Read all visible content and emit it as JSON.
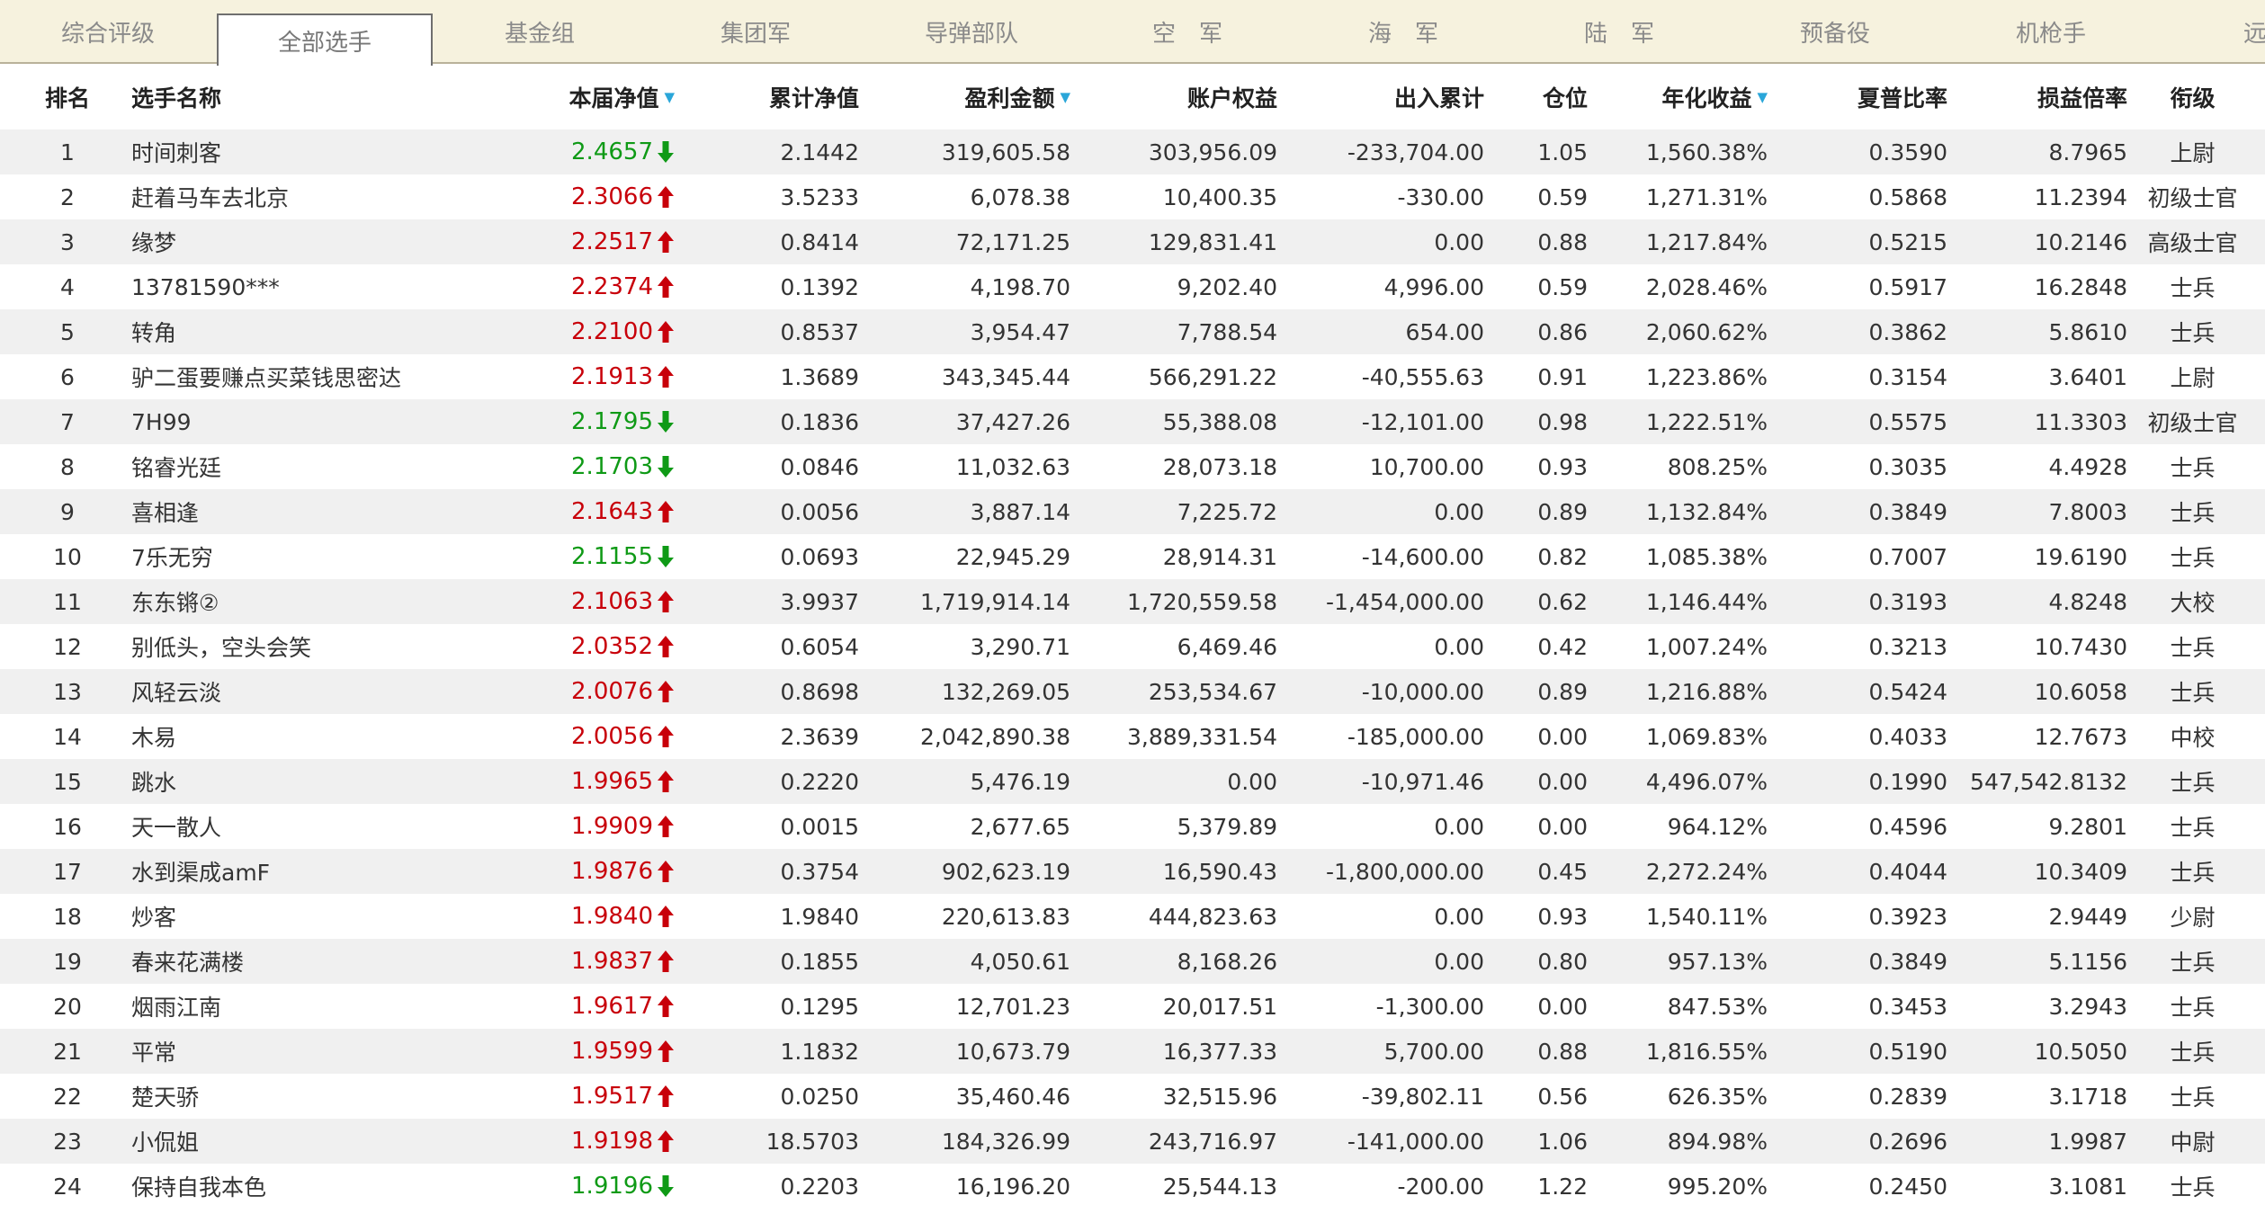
{
  "tabs": [
    {
      "label": "综合评级",
      "active": false
    },
    {
      "label": "全部选手",
      "active": true
    },
    {
      "label": "基金组",
      "active": false
    },
    {
      "label": "集团军",
      "active": false
    },
    {
      "label": "导弹部队",
      "active": false
    },
    {
      "label": "空　军",
      "active": false
    },
    {
      "label": "海　军",
      "active": false
    },
    {
      "label": "陆　军",
      "active": false
    },
    {
      "label": "预备役",
      "active": false
    },
    {
      "label": "机枪手",
      "active": false
    },
    {
      "label": "远征",
      "active": false
    }
  ],
  "columns": [
    {
      "key": "rank",
      "label": "排名",
      "sortable": false
    },
    {
      "key": "name",
      "label": "选手名称",
      "sortable": false
    },
    {
      "key": "nav",
      "label": "本届净值",
      "sortable": true
    },
    {
      "key": "cum_nav",
      "label": "累计净值",
      "sortable": false
    },
    {
      "key": "profit",
      "label": "盈利金额",
      "sortable": true
    },
    {
      "key": "equity",
      "label": "账户权益",
      "sortable": false
    },
    {
      "key": "flow",
      "label": "出入累计",
      "sortable": false
    },
    {
      "key": "position",
      "label": "仓位",
      "sortable": false
    },
    {
      "key": "annual",
      "label": "年化收益",
      "sortable": true
    },
    {
      "key": "sharpe",
      "label": "夏普比率",
      "sortable": false
    },
    {
      "key": "pl_ratio",
      "label": "损益倍率",
      "sortable": false
    },
    {
      "key": "rank_title",
      "label": "衔级",
      "sortable": false
    }
  ],
  "sort_indicator": "▼",
  "colors": {
    "up": "#c8000a",
    "down": "#0f9a16",
    "sort": "#2aa6d9",
    "tabbar": "#f6f2de",
    "row_alt": "#f0f0f0"
  },
  "rows": [
    {
      "rank": "1",
      "name": "时间刺客",
      "nav": "2.4657",
      "dir": "down",
      "cum_nav": "2.1442",
      "profit": "319,605.58",
      "equity": "303,956.09",
      "flow": "-233,704.00",
      "position": "1.05",
      "annual": "1,560.38%",
      "sharpe": "0.3590",
      "pl_ratio": "8.7965",
      "rank_title": "上尉"
    },
    {
      "rank": "2",
      "name": "赶着马车去北京",
      "nav": "2.3066",
      "dir": "up",
      "cum_nav": "3.5233",
      "profit": "6,078.38",
      "equity": "10,400.35",
      "flow": "-330.00",
      "position": "0.59",
      "annual": "1,271.31%",
      "sharpe": "0.5868",
      "pl_ratio": "11.2394",
      "rank_title": "初级士官"
    },
    {
      "rank": "3",
      "name": "缘梦",
      "nav": "2.2517",
      "dir": "up",
      "cum_nav": "0.8414",
      "profit": "72,171.25",
      "equity": "129,831.41",
      "flow": "0.00",
      "position": "0.88",
      "annual": "1,217.84%",
      "sharpe": "0.5215",
      "pl_ratio": "10.2146",
      "rank_title": "高级士官"
    },
    {
      "rank": "4",
      "name": "13781590***",
      "nav": "2.2374",
      "dir": "up",
      "cum_nav": "0.1392",
      "profit": "4,198.70",
      "equity": "9,202.40",
      "flow": "4,996.00",
      "position": "0.59",
      "annual": "2,028.46%",
      "sharpe": "0.5917",
      "pl_ratio": "16.2848",
      "rank_title": "士兵"
    },
    {
      "rank": "5",
      "name": "转角",
      "nav": "2.2100",
      "dir": "up",
      "cum_nav": "0.8537",
      "profit": "3,954.47",
      "equity": "7,788.54",
      "flow": "654.00",
      "position": "0.86",
      "annual": "2,060.62%",
      "sharpe": "0.3862",
      "pl_ratio": "5.8610",
      "rank_title": "士兵"
    },
    {
      "rank": "6",
      "name": "驴二蛋要赚点买菜钱思密达",
      "nav": "2.1913",
      "dir": "up",
      "cum_nav": "1.3689",
      "profit": "343,345.44",
      "equity": "566,291.22",
      "flow": "-40,555.63",
      "position": "0.91",
      "annual": "1,223.86%",
      "sharpe": "0.3154",
      "pl_ratio": "3.6401",
      "rank_title": "上尉"
    },
    {
      "rank": "7",
      "name": "7H99",
      "nav": "2.1795",
      "dir": "down",
      "cum_nav": "0.1836",
      "profit": "37,427.26",
      "equity": "55,388.08",
      "flow": "-12,101.00",
      "position": "0.98",
      "annual": "1,222.51%",
      "sharpe": "0.5575",
      "pl_ratio": "11.3303",
      "rank_title": "初级士官"
    },
    {
      "rank": "8",
      "name": "铭睿光廷",
      "nav": "2.1703",
      "dir": "down",
      "cum_nav": "0.0846",
      "profit": "11,032.63",
      "equity": "28,073.18",
      "flow": "10,700.00",
      "position": "0.93",
      "annual": "808.25%",
      "sharpe": "0.3035",
      "pl_ratio": "4.4928",
      "rank_title": "士兵"
    },
    {
      "rank": "9",
      "name": "喜相逢",
      "nav": "2.1643",
      "dir": "up",
      "cum_nav": "0.0056",
      "profit": "3,887.14",
      "equity": "7,225.72",
      "flow": "0.00",
      "position": "0.89",
      "annual": "1,132.84%",
      "sharpe": "0.3849",
      "pl_ratio": "7.8003",
      "rank_title": "士兵"
    },
    {
      "rank": "10",
      "name": "7乐无穷",
      "nav": "2.1155",
      "dir": "down",
      "cum_nav": "0.0693",
      "profit": "22,945.29",
      "equity": "28,914.31",
      "flow": "-14,600.00",
      "position": "0.82",
      "annual": "1,085.38%",
      "sharpe": "0.7007",
      "pl_ratio": "19.6190",
      "rank_title": "士兵"
    },
    {
      "rank": "11",
      "name": "东东锵②",
      "nav": "2.1063",
      "dir": "up",
      "cum_nav": "3.9937",
      "profit": "1,719,914.14",
      "equity": "1,720,559.58",
      "flow": "-1,454,000.00",
      "position": "0.62",
      "annual": "1,146.44%",
      "sharpe": "0.3193",
      "pl_ratio": "4.8248",
      "rank_title": "大校"
    },
    {
      "rank": "12",
      "name": "别低头，空头会笑",
      "nav": "2.0352",
      "dir": "up",
      "cum_nav": "0.6054",
      "profit": "3,290.71",
      "equity": "6,469.46",
      "flow": "0.00",
      "position": "0.42",
      "annual": "1,007.24%",
      "sharpe": "0.3213",
      "pl_ratio": "10.7430",
      "rank_title": "士兵"
    },
    {
      "rank": "13",
      "name": "风轻云淡",
      "nav": "2.0076",
      "dir": "up",
      "cum_nav": "0.8698",
      "profit": "132,269.05",
      "equity": "253,534.67",
      "flow": "-10,000.00",
      "position": "0.89",
      "annual": "1,216.88%",
      "sharpe": "0.5424",
      "pl_ratio": "10.6058",
      "rank_title": "士兵"
    },
    {
      "rank": "14",
      "name": "木易",
      "nav": "2.0056",
      "dir": "up",
      "cum_nav": "2.3639",
      "profit": "2,042,890.38",
      "equity": "3,889,331.54",
      "flow": "-185,000.00",
      "position": "0.00",
      "annual": "1,069.83%",
      "sharpe": "0.4033",
      "pl_ratio": "12.7673",
      "rank_title": "中校"
    },
    {
      "rank": "15",
      "name": "跳水",
      "nav": "1.9965",
      "dir": "up",
      "cum_nav": "0.2220",
      "profit": "5,476.19",
      "equity": "0.00",
      "flow": "-10,971.46",
      "position": "0.00",
      "annual": "4,496.07%",
      "sharpe": "0.1990",
      "pl_ratio": "547,542.8132",
      "rank_title": "士兵"
    },
    {
      "rank": "16",
      "name": "天一散人",
      "nav": "1.9909",
      "dir": "up",
      "cum_nav": "0.0015",
      "profit": "2,677.65",
      "equity": "5,379.89",
      "flow": "0.00",
      "position": "0.00",
      "annual": "964.12%",
      "sharpe": "0.4596",
      "pl_ratio": "9.2801",
      "rank_title": "士兵"
    },
    {
      "rank": "17",
      "name": "水到渠成amF",
      "nav": "1.9876",
      "dir": "up",
      "cum_nav": "0.3754",
      "profit": "902,623.19",
      "equity": "16,590.43",
      "flow": "-1,800,000.00",
      "position": "0.45",
      "annual": "2,272.24%",
      "sharpe": "0.4044",
      "pl_ratio": "10.3409",
      "rank_title": "士兵"
    },
    {
      "rank": "18",
      "name": "炒客",
      "nav": "1.9840",
      "dir": "up",
      "cum_nav": "1.9840",
      "profit": "220,613.83",
      "equity": "444,823.63",
      "flow": "0.00",
      "position": "0.93",
      "annual": "1,540.11%",
      "sharpe": "0.3923",
      "pl_ratio": "2.9449",
      "rank_title": "少尉"
    },
    {
      "rank": "19",
      "name": "春来花满楼",
      "nav": "1.9837",
      "dir": "up",
      "cum_nav": "0.1855",
      "profit": "4,050.61",
      "equity": "8,168.26",
      "flow": "0.00",
      "position": "0.80",
      "annual": "957.13%",
      "sharpe": "0.3849",
      "pl_ratio": "5.1156",
      "rank_title": "士兵"
    },
    {
      "rank": "20",
      "name": "烟雨江南",
      "nav": "1.9617",
      "dir": "up",
      "cum_nav": "0.1295",
      "profit": "12,701.23",
      "equity": "20,017.51",
      "flow": "-1,300.00",
      "position": "0.00",
      "annual": "847.53%",
      "sharpe": "0.3453",
      "pl_ratio": "3.2943",
      "rank_title": "士兵"
    },
    {
      "rank": "21",
      "name": "平常",
      "nav": "1.9599",
      "dir": "up",
      "cum_nav": "1.1832",
      "profit": "10,673.79",
      "equity": "16,377.33",
      "flow": "5,700.00",
      "position": "0.88",
      "annual": "1,816.55%",
      "sharpe": "0.5190",
      "pl_ratio": "10.5050",
      "rank_title": "士兵"
    },
    {
      "rank": "22",
      "name": "楚天骄",
      "nav": "1.9517",
      "dir": "up",
      "cum_nav": "0.0250",
      "profit": "35,460.46",
      "equity": "32,515.96",
      "flow": "-39,802.11",
      "position": "0.56",
      "annual": "626.35%",
      "sharpe": "0.2839",
      "pl_ratio": "3.1718",
      "rank_title": "士兵"
    },
    {
      "rank": "23",
      "name": "小侃姐",
      "nav": "1.9198",
      "dir": "up",
      "cum_nav": "18.5703",
      "profit": "184,326.99",
      "equity": "243,716.97",
      "flow": "-141,000.00",
      "position": "1.06",
      "annual": "894.98%",
      "sharpe": "0.2696",
      "pl_ratio": "1.9987",
      "rank_title": "中尉"
    },
    {
      "rank": "24",
      "name": "保持自我本色",
      "nav": "1.9196",
      "dir": "down",
      "cum_nav": "0.2203",
      "profit": "16,196.20",
      "equity": "25,544.13",
      "flow": "-200.00",
      "position": "1.22",
      "annual": "995.20%",
      "sharpe": "0.2450",
      "pl_ratio": "3.1081",
      "rank_title": "士兵"
    }
  ]
}
